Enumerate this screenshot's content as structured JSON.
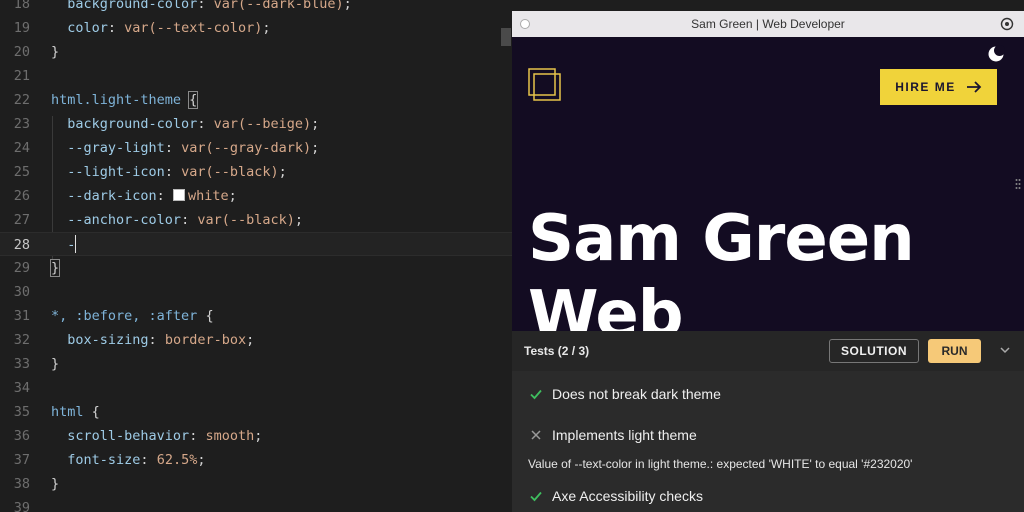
{
  "editor": {
    "lines": [
      {
        "n": "18",
        "tokens": [
          [
            "  ",
            "punc"
          ],
          [
            "background-color",
            "prop"
          ],
          [
            ": ",
            "punc"
          ],
          [
            "var(--dark-blue)",
            "val"
          ],
          [
            ";",
            "punc"
          ]
        ]
      },
      {
        "n": "19",
        "tokens": [
          [
            "  ",
            "punc"
          ],
          [
            "color",
            "prop"
          ],
          [
            ": ",
            "punc"
          ],
          [
            "var(--text-color)",
            "val"
          ],
          [
            ";",
            "punc"
          ]
        ]
      },
      {
        "n": "20",
        "tokens": [
          [
            "}",
            "punc"
          ]
        ]
      },
      {
        "n": "21",
        "tokens": []
      },
      {
        "n": "22",
        "tokens": [
          [
            "html.light-theme ",
            "sel"
          ],
          [
            "{",
            "brk"
          ]
        ]
      },
      {
        "n": "23",
        "tokens": [
          [
            "  ",
            "punc"
          ],
          [
            "background-color",
            "prop"
          ],
          [
            ": ",
            "punc"
          ],
          [
            "var(--beige)",
            "val"
          ],
          [
            ";",
            "punc"
          ]
        ]
      },
      {
        "n": "24",
        "tokens": [
          [
            "  ",
            "punc"
          ],
          [
            "--gray-light",
            "prop"
          ],
          [
            ": ",
            "punc"
          ],
          [
            "var(--gray-dark)",
            "val"
          ],
          [
            ";",
            "punc"
          ]
        ]
      },
      {
        "n": "25",
        "tokens": [
          [
            "  ",
            "punc"
          ],
          [
            "--light-icon",
            "prop"
          ],
          [
            ": ",
            "punc"
          ],
          [
            "var(--black)",
            "val"
          ],
          [
            ";",
            "punc"
          ]
        ]
      },
      {
        "n": "26",
        "tokens": [
          [
            "  ",
            "punc"
          ],
          [
            "--dark-icon",
            "prop"
          ],
          [
            ": ",
            "punc"
          ],
          [
            "■",
            "swatch"
          ],
          [
            "white",
            "val"
          ],
          [
            ";",
            "punc"
          ]
        ]
      },
      {
        "n": "27",
        "tokens": [
          [
            "  ",
            "punc"
          ],
          [
            "--anchor-color",
            "prop"
          ],
          [
            ": ",
            "punc"
          ],
          [
            "var(--black)",
            "val"
          ],
          [
            ";",
            "punc"
          ]
        ]
      },
      {
        "n": "28",
        "tokens": [
          [
            "  ",
            "punc"
          ],
          [
            "-",
            "prop"
          ],
          [
            "|",
            "cursor"
          ]
        ],
        "active": true
      },
      {
        "n": "29",
        "tokens": [
          [
            "}",
            "brk"
          ]
        ]
      },
      {
        "n": "30",
        "tokens": []
      },
      {
        "n": "31",
        "tokens": [
          [
            "*, :before, :after ",
            "sel"
          ],
          [
            "{",
            "punc"
          ]
        ]
      },
      {
        "n": "32",
        "tokens": [
          [
            "  ",
            "punc"
          ],
          [
            "box-sizing",
            "prop"
          ],
          [
            ": ",
            "punc"
          ],
          [
            "border-box",
            "val"
          ],
          [
            ";",
            "punc"
          ]
        ]
      },
      {
        "n": "33",
        "tokens": [
          [
            "}",
            "punc"
          ]
        ]
      },
      {
        "n": "34",
        "tokens": []
      },
      {
        "n": "35",
        "tokens": [
          [
            "html ",
            "sel"
          ],
          [
            "{",
            "punc"
          ]
        ]
      },
      {
        "n": "36",
        "tokens": [
          [
            "  ",
            "punc"
          ],
          [
            "scroll-behavior",
            "prop"
          ],
          [
            ": ",
            "punc"
          ],
          [
            "smooth",
            "val"
          ],
          [
            ";",
            "punc"
          ]
        ]
      },
      {
        "n": "37",
        "tokens": [
          [
            "  ",
            "punc"
          ],
          [
            "font-size",
            "prop"
          ],
          [
            ": ",
            "punc"
          ],
          [
            "62.5%",
            "val"
          ],
          [
            ";",
            "punc"
          ]
        ]
      },
      {
        "n": "38",
        "tokens": [
          [
            "}",
            "punc"
          ]
        ]
      },
      {
        "n": "39",
        "tokens": []
      }
    ]
  },
  "preview": {
    "window_title": "Sam Green | Web Developer",
    "hire_button": "HIRE ME",
    "hero_line1": "Sam Green",
    "hero_line2": "Web"
  },
  "tests": {
    "title": "Tests (2 / 3)",
    "solution_label": "SOLUTION",
    "run_label": "RUN",
    "items": [
      {
        "label": "Does not break dark theme",
        "status": "pass"
      },
      {
        "label": "Implements light theme",
        "status": "fail"
      },
      {
        "label": "Axe Accessibility checks",
        "status": "pass"
      }
    ],
    "error_message": "Value of --text-color in light theme.: expected 'WHITE' to equal '#232020'"
  },
  "colors": {
    "accent_yellow": "#f0d33a",
    "run_button": "#f6c978",
    "pass_green": "#3fbf5f",
    "fail_gray": "#9a9a9a",
    "preview_bg": "#130c22"
  }
}
